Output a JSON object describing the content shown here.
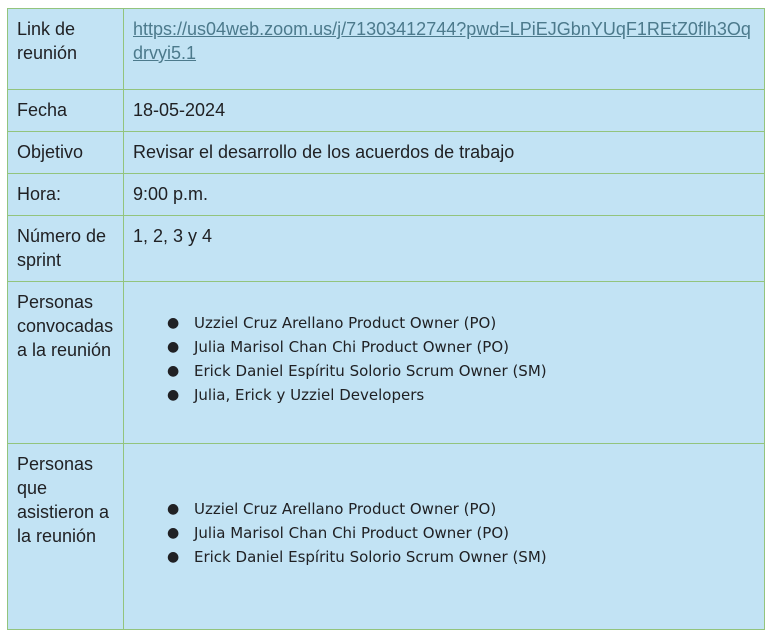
{
  "rows": {
    "link": {
      "label": "Link de reunión",
      "value": "https://us04web.zoom.us/j/71303412744?pwd=LPiEJGbnYUqF1REtZ0flh3Oqdrvyi5.1"
    },
    "date": {
      "label": "Fecha",
      "value": "18-05-2024"
    },
    "objective": {
      "label": "Objetivo",
      "value": "Revisar el desarrollo de los acuerdos de trabajo"
    },
    "hour": {
      "label": "Hora:",
      "value": "9:00 p.m."
    },
    "sprint": {
      "label": "Número de sprint",
      "value": "1, 2, 3 y 4"
    },
    "convoked": {
      "label": "Personas convocadas a la reunión",
      "items": [
        "Uzziel Cruz Arellano Product Owner (PO)",
        "Julia Marisol Chan Chi Product Owner (PO)",
        "Erick Daniel Espíritu Solorio Scrum Owner (SM)",
        "Julia, Erick y Uzziel Developers"
      ]
    },
    "attended": {
      "label": "Personas que asistieron a la reunión",
      "items": [
        "Uzziel Cruz Arellano Product Owner (PO)",
        "Julia Marisol Chan Chi Product Owner (PO)",
        "Erick Daniel Espíritu Solorio Scrum Owner (SM)"
      ]
    }
  },
  "bullet_glyph": "●",
  "colors": {
    "cell_background": "#c2e3f4",
    "border": "#93c47d",
    "link": "#4c7a8c"
  }
}
